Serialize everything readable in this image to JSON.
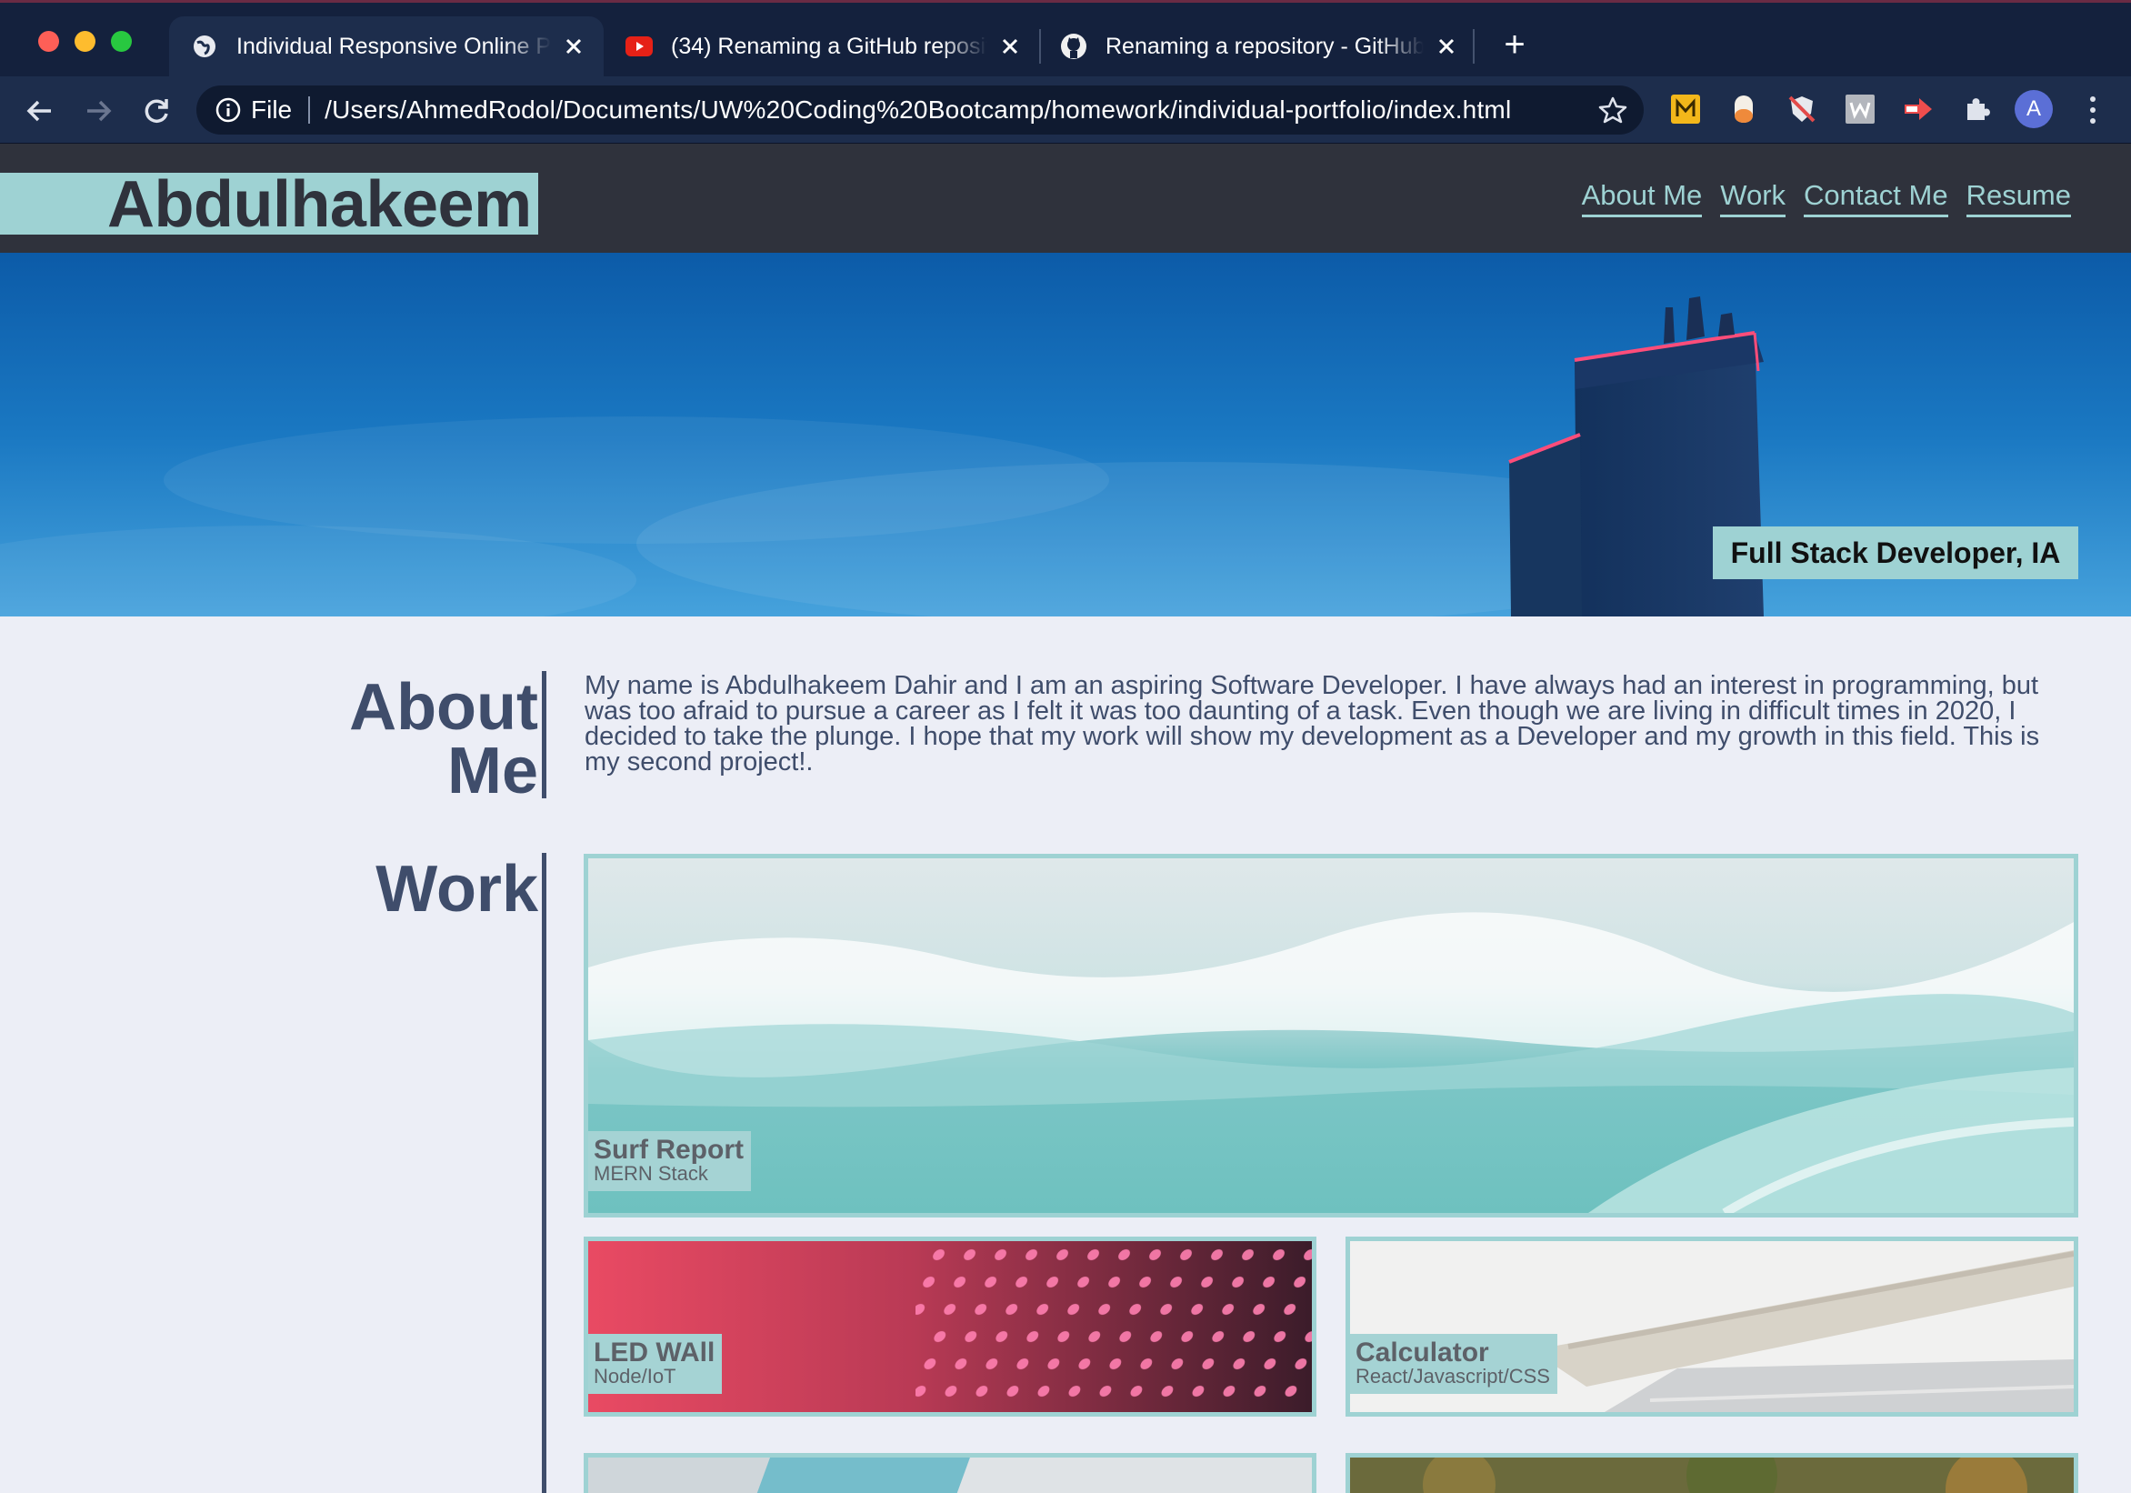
{
  "browser": {
    "tabs": [
      {
        "title": "Individual Responsive Online Portfolio",
        "icon": "globe-icon",
        "active": true
      },
      {
        "title": "(34) Renaming a GitHub repository",
        "icon": "youtube-icon",
        "active": false
      },
      {
        "title": "Renaming a repository - GitHub Docs",
        "icon": "github-icon",
        "active": false
      }
    ],
    "new_tab": "+",
    "omnibox": {
      "scheme_label": "File",
      "url": "/Users/AhmedRodol/Documents/UW%20Coding%20Bootcamp/homework/individual-portfolio/index.html"
    },
    "profile_initial": "A",
    "extensions": [
      "m-extension-icon",
      "capsule-extension-icon",
      "shield-extension-icon",
      "w-extension-icon",
      "arrow-extension-icon",
      "puzzle-icon"
    ]
  },
  "site": {
    "logo": "Abdulhakeem",
    "nav": [
      "About Me",
      "Work",
      "Contact Me",
      "Resume"
    ],
    "hero_badge": "Full Stack Developer, IA",
    "about": {
      "heading_line1": "About",
      "heading_line2": "Me",
      "text": "My name is Abdulhakeem Dahir and I am an aspiring Software Developer. I have always had an interest in programming, but was too afraid to pursue a career as I felt it was too daunting of a task. Even though we are living in difficult times in 2020, I decided to take the plunge. I hope that my work will show my development as a Developer and my growth in this field. This is my second project!."
    },
    "work": {
      "heading": "Work",
      "projects": [
        {
          "title": "Surf Report",
          "stack": "MERN Stack"
        },
        {
          "title": "LED WAll",
          "stack": "Node/IoT"
        },
        {
          "title": "Calculator",
          "stack": "React/Javascript/CSS"
        }
      ]
    }
  },
  "colors": {
    "chrome_bg": "#14213d",
    "toolbar_bg": "#1d2d4c",
    "header_bg": "#2f323c",
    "accent_teal": "#9ed2d3",
    "heading_slate": "#3f4d6b",
    "page_bg": "#eceef6"
  }
}
